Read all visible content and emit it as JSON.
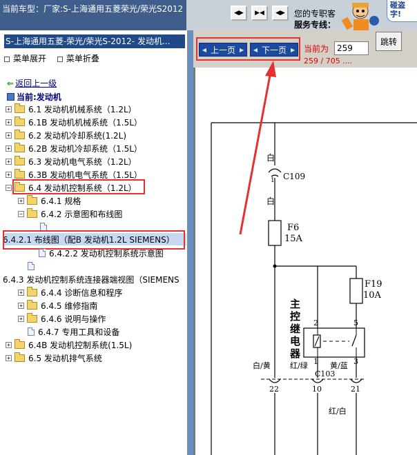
{
  "header": {
    "car_model": "当前车型：厂家:S-上海通用五菱荣光/荣光S2012",
    "hotline_line1": "您的专职客",
    "hotline_line2": "服务专线：",
    "bubble_text": "碰盗字!"
  },
  "tree": {
    "title": "S-上海通用五菱-荣光/荣光S-2012- 发动机...",
    "expand_label": "菜单展开",
    "collapse_label": "菜单折叠",
    "back_label": "返回上一级",
    "current_label": "当前:发动机",
    "items": [
      {
        "label": "6.1 发动机机械系统（1.2L）"
      },
      {
        "label": "6.1B 发动机机械系统（1.5L）"
      },
      {
        "label": "6.2 发动机冷却系统(1.2L)"
      },
      {
        "label": "6.2B 发动机冷却系统（1.5L）"
      },
      {
        "label": "6.3 发动机电气系统（1.2L）"
      },
      {
        "label": "6.3B 发动机电气系统（1.5L）"
      },
      {
        "label": "6.4 发动机控制系统（1.2L）"
      },
      {
        "label": "6.4.1 规格"
      },
      {
        "label": "6.4.2 示意图和布线图"
      },
      {
        "label": ""
      },
      {
        "label": "6.4.2.1 布线图（配B 发动机1.2L SIEMENS）"
      },
      {
        "label": "6.4.2.2 发动机控制系统示意图"
      },
      {
        "label": ""
      },
      {
        "label": "6.4.3 发动机控制系统连接器端视图（SIEMENS"
      },
      {
        "label": "6.4.4 诊断信息和程序"
      },
      {
        "label": "6.4.5 维修指南"
      },
      {
        "label": "6.4.6 说明与操作"
      },
      {
        "label": "6.4.7 专用工具和设备"
      },
      {
        "label": "6.4B 发动机控制系统(1.5L)"
      },
      {
        "label": "6.5 发动机排气系统"
      }
    ]
  },
  "pager": {
    "prev_label": "上一页",
    "next_label": "下一页",
    "current_label": "当前为",
    "current_value": "259",
    "jump_label": "跳转",
    "page_count": "259 / 705 ...."
  },
  "diagram": {
    "labels": {
      "bai1": "白",
      "c109": "C109",
      "bai2": "白",
      "f6": "F6",
      "f6_amp": "15A",
      "f19": "F19",
      "f19_amp": "10A",
      "relay": [
        "主",
        "控",
        "继",
        "电",
        "器"
      ],
      "pin2": "2",
      "pin5": "5",
      "pin1": "1",
      "pin3": "3",
      "c103": "C103",
      "w_left": "白/黄",
      "w_mid": "红/绿",
      "w_right": "黄/蓝",
      "p22": "22",
      "p10": "10",
      "p21": "21",
      "w_bottom": "红/白"
    }
  },
  "colors": {
    "title_bar": "#204a87",
    "header_left": "#3f5e8c",
    "highlight_red": "#e53030",
    "pager_button": "#1c4aa0",
    "page_text_red": "#e00000"
  }
}
